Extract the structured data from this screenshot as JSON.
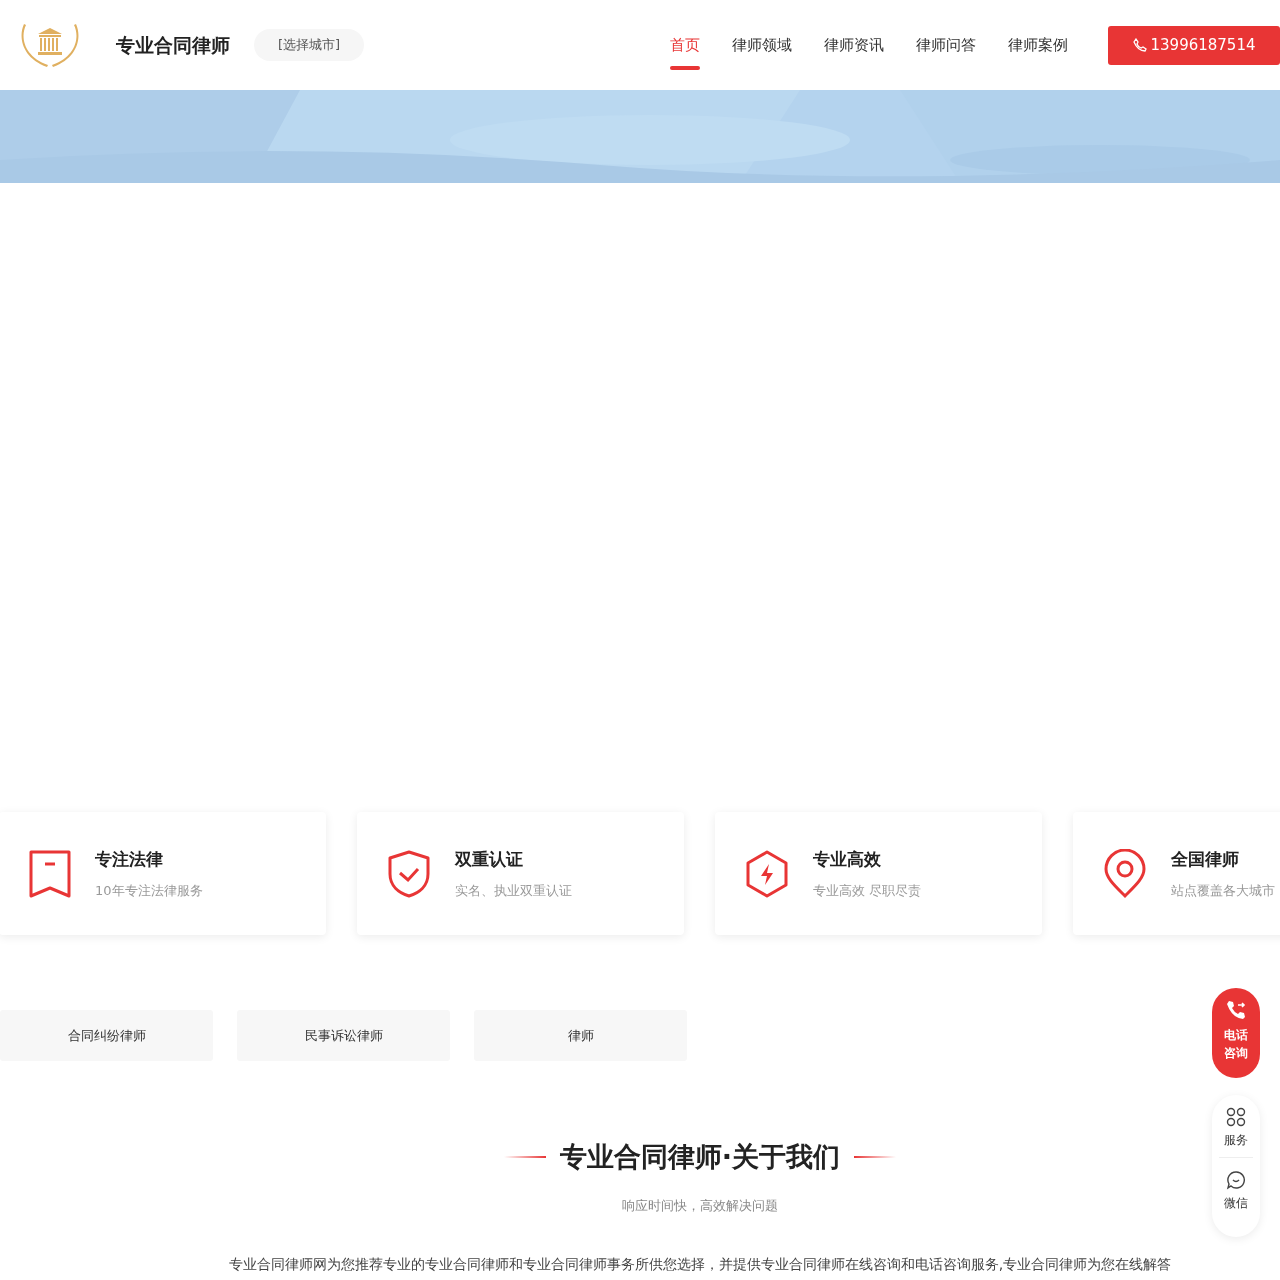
{
  "header": {
    "site_title": "专业合同律师",
    "city_button": "[选择城市]",
    "nav": [
      {
        "label": "首页",
        "selected": true
      },
      {
        "label": "律师领域",
        "selected": false
      },
      {
        "label": "律师资讯",
        "selected": false
      },
      {
        "label": "律师问答",
        "selected": false
      },
      {
        "label": "律师案例",
        "selected": false
      }
    ],
    "phone": "13996187514"
  },
  "hero": {
    "kind": "picture"
  },
  "features": [
    {
      "title": "专注法律",
      "subtitle": "10年专注法律服务"
    },
    {
      "title": "双重认证",
      "subtitle": "实名、执业双重认证"
    },
    {
      "title": "专业高效",
      "subtitle": "专业高效 尽职尽责"
    },
    {
      "title": "全国律师",
      "subtitle": "站点覆盖各大城市"
    }
  ],
  "tags": [
    "合同纠纷律师",
    "民事诉讼律师",
    "律师"
  ],
  "about": {
    "title": "专业合同律师·关于我们",
    "subtitle": "响应时间快，高效解决问题",
    "text": "专业合同律师网为您推荐专业的专业合同律师和专业合同律师事务所供您选择，并提供专业合同律师在线咨询和电话咨询服务,专业合同律师为您在线解答"
  },
  "side": {
    "call": "电话咨询",
    "items": [
      {
        "label": "服务"
      },
      {
        "label": "微信"
      }
    ]
  }
}
